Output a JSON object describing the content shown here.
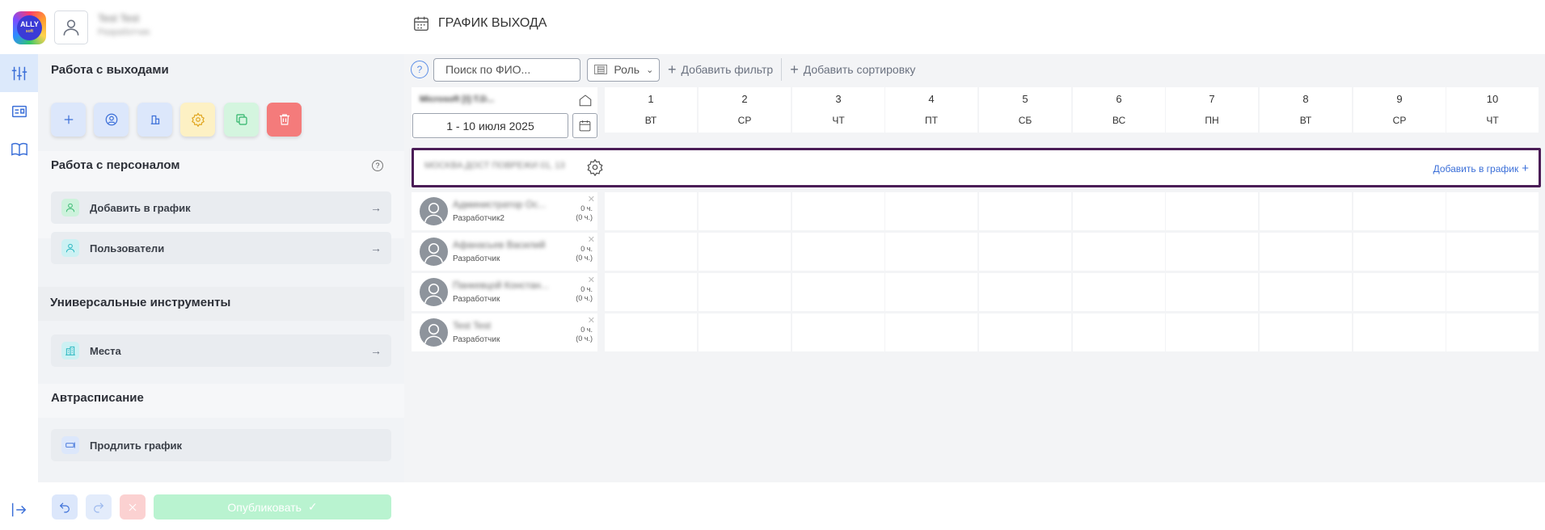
{
  "app": {
    "logo_text": "ALLY",
    "logo_sub": "soft"
  },
  "user": {
    "name": "Test Test",
    "role": "Разработчик"
  },
  "page": {
    "title": "ГРАФИК ВЫХОДА"
  },
  "sidebar": {
    "section_shifts": "Работа с выходами",
    "section_staff": "Работа с персоналом",
    "staff_items": [
      {
        "label": "Добавить в график",
        "icon": "user-add-icon"
      },
      {
        "label": "Пользователи",
        "icon": "user-icon"
      }
    ],
    "section_tools": "Универсальные инструменты",
    "tools_items": [
      {
        "label": "Места",
        "icon": "building-icon"
      }
    ],
    "section_auto": "Автрасписание",
    "auto_items": [
      {
        "label": "Продлить график",
        "icon": "extend-icon"
      }
    ],
    "publish_label": "Опубликовать"
  },
  "filters": {
    "help": "?",
    "search_placeholder": "Поиск по ФИО...",
    "role_label": "Роль",
    "add_filter": "Добавить фильтр",
    "add_sort": "Добавить сортировку"
  },
  "schedule": {
    "department": "Microsoft [I]:T.D...",
    "date_range": "1 - 10 июля 2025",
    "days": [
      {
        "num": "1",
        "wd": "ВТ"
      },
      {
        "num": "2",
        "wd": "СР"
      },
      {
        "num": "3",
        "wd": "ЧТ"
      },
      {
        "num": "4",
        "wd": "ПТ"
      },
      {
        "num": "5",
        "wd": "СБ"
      },
      {
        "num": "6",
        "wd": "ВС"
      },
      {
        "num": "7",
        "wd": "ПН"
      },
      {
        "num": "8",
        "wd": "ВТ"
      },
      {
        "num": "9",
        "wd": "СР"
      },
      {
        "num": "10",
        "wd": "ЧТ"
      }
    ],
    "group_name": "MOCKBA ДОСТ ПОВРЕЖИ 01, 13",
    "add_to_schedule": "Добавить в график",
    "employees": [
      {
        "name": "Администратор Ос...",
        "role": "Разработчик2",
        "hours": "0 ч.",
        "hours_alt": "(0 ч.)"
      },
      {
        "name": "Афанасьев Василий",
        "role": "Разработчик",
        "hours": "0 ч.",
        "hours_alt": "(0 ч.)"
      },
      {
        "name": "Панкевцой Констан...",
        "role": "Разработчик",
        "hours": "0 ч.",
        "hours_alt": "(0 ч.)"
      },
      {
        "name": "Test Test",
        "role": "Разработчик",
        "hours": "0 ч.",
        "hours_alt": "(0 ч.)"
      }
    ]
  },
  "colors": {
    "accent": "#3b6fd8",
    "group_border": "#4b1d57",
    "publish_bg": "#b9f3d0",
    "panel_bg": "#f1f3f6"
  }
}
